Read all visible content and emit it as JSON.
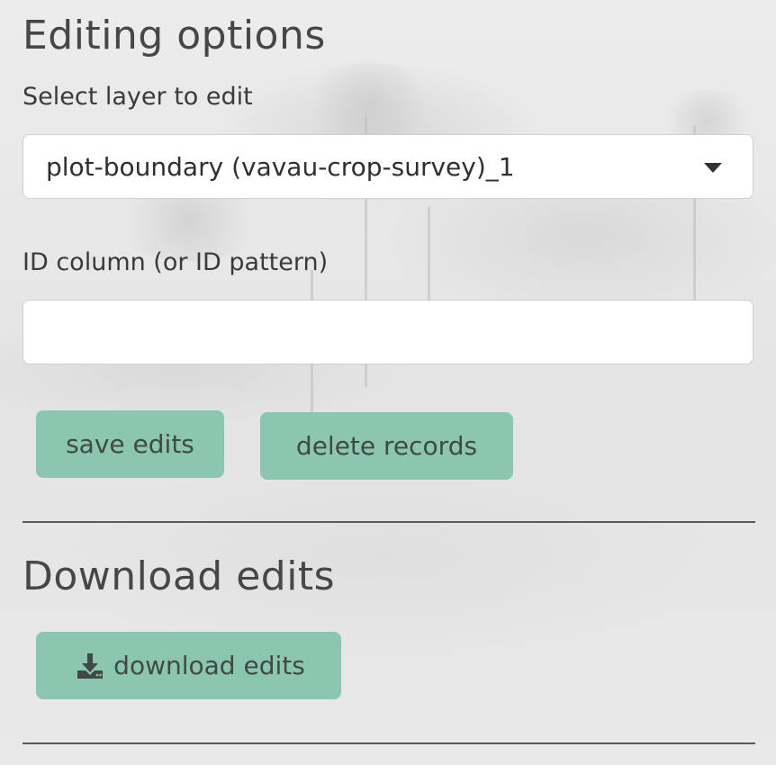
{
  "editing": {
    "heading": "Editing options",
    "layer_label": "Select layer to edit",
    "layer_selected": "plot-boundary (vavau-crop-survey)_1",
    "id_label": "ID column (or ID pattern)",
    "id_value": "",
    "save_label": "save edits",
    "delete_label": "delete records"
  },
  "download": {
    "heading": "Download edits",
    "button_label": "download edits",
    "icon": "download-icon"
  },
  "colors": {
    "button_bg": "#8cc5b0",
    "text": "#3f3f3f",
    "divider": "#5a5a5a"
  }
}
